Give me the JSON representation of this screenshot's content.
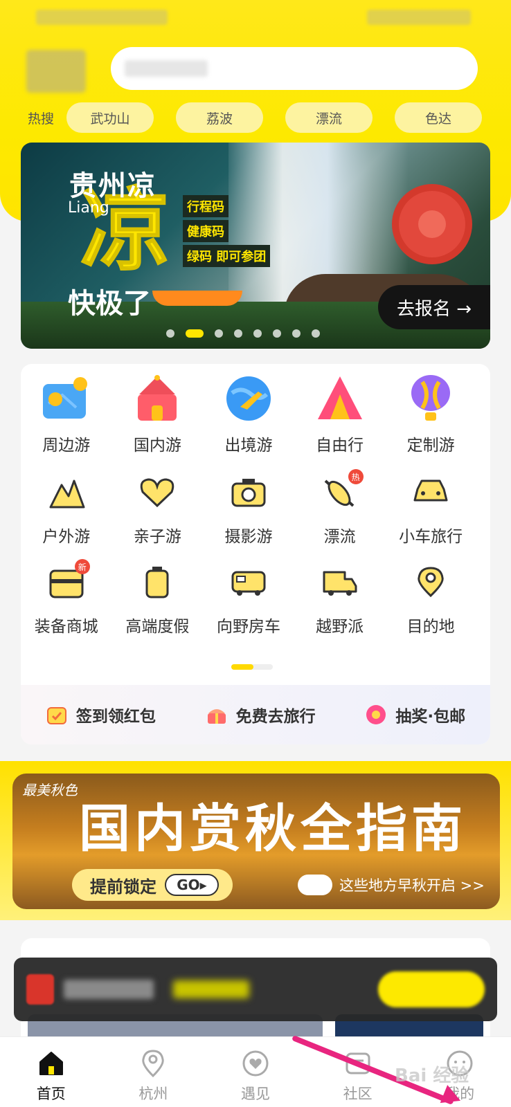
{
  "search": {
    "hot_label": "热搜",
    "hot_terms": [
      "武功山",
      "荔波",
      "漂流",
      "色达"
    ]
  },
  "banner": {
    "title": "贵州凉",
    "subtitle_en": "Liang",
    "big_char": "凉",
    "tagline": "快极了",
    "tags": [
      "行程码",
      "健康码",
      "绿码 即可参团"
    ],
    "cta": "去报名 →",
    "dots_total": 8,
    "active_dot": 2
  },
  "categories": {
    "row1": [
      {
        "label": "周边游",
        "icon": "map-pin-icon"
      },
      {
        "label": "国内游",
        "icon": "pagoda-icon"
      },
      {
        "label": "出境游",
        "icon": "globe-plane-icon"
      },
      {
        "label": "自由行",
        "icon": "tent-icon"
      },
      {
        "label": "定制游",
        "icon": "hot-air-balloon-icon"
      }
    ],
    "row2": [
      {
        "label": "户外游",
        "icon": "mountain-icon"
      },
      {
        "label": "亲子游",
        "icon": "heart-icon"
      },
      {
        "label": "摄影游",
        "icon": "camera-icon"
      },
      {
        "label": "漂流",
        "icon": "kayak-icon",
        "badge": "热"
      },
      {
        "label": "小车旅行",
        "icon": "car-icon"
      }
    ],
    "row3": [
      {
        "label": "装备商城",
        "icon": "backpack-icon",
        "badge": "新"
      },
      {
        "label": "高端度假",
        "icon": "suitcase-icon"
      },
      {
        "label": "向野房车",
        "icon": "rv-icon"
      },
      {
        "label": "越野派",
        "icon": "truck-icon"
      },
      {
        "label": "目的地",
        "icon": "location-icon"
      }
    ]
  },
  "promos": [
    {
      "label": "签到领红包",
      "icon": "calendar-check-icon"
    },
    {
      "label": "免费去旅行",
      "icon": "gift-box-icon"
    },
    {
      "label": "抽奖·包邮",
      "icon": "lottery-wheel-icon"
    }
  ],
  "autumn": {
    "tag": "最美秋色",
    "title": "国内赏秋全指南",
    "button": "提前锁定",
    "go": "GO▸",
    "right_text": "这些地方早秋开启 >>"
  },
  "nav": [
    {
      "label": "首页",
      "icon": "home-icon",
      "active": true
    },
    {
      "label": "杭州",
      "icon": "location-pin-icon"
    },
    {
      "label": "遇见",
      "icon": "heart-circle-icon"
    },
    {
      "label": "社区",
      "icon": "community-icon"
    },
    {
      "label": "我的",
      "icon": "profile-icon"
    }
  ],
  "watermark": "Bai 经验",
  "colors": {
    "brand_yellow": "#fde900",
    "annotation_arrow": "#e8257f"
  }
}
